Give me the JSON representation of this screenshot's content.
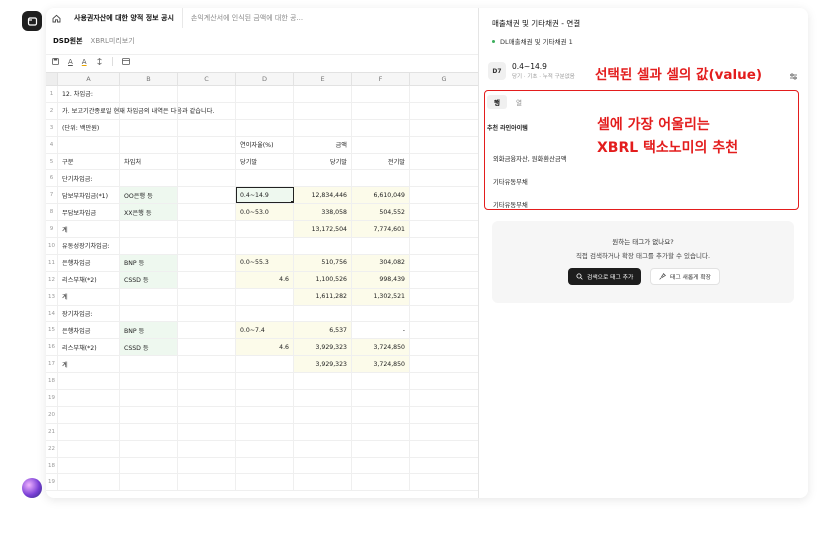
{
  "tabs": {
    "active": "사용권자산에 대한 양적 정보 공시",
    "inactive": "손익계산서에 인식된 금액에 대한 공..."
  },
  "subtabs": [
    "DSD원본",
    "XBRL미리보기"
  ],
  "toolbar": {
    "text_a": "A",
    "fill_a": "A"
  },
  "grid": {
    "columns": [
      "A",
      "B",
      "C",
      "D",
      "E",
      "F",
      "G"
    ],
    "rows": [
      {
        "n": "1",
        "a": "12. 차입금:",
        "b": "",
        "d": "",
        "e": "",
        "f": ""
      },
      {
        "n": "2",
        "a": "가. 보고기간종료일 현재 차입금의 내역은 다음과 같습니다.",
        "b": "",
        "d": "",
        "e": "",
        "f": ""
      },
      {
        "n": "3",
        "a": "(단위: 백만원)",
        "b": "",
        "d": "",
        "e": "",
        "f": ""
      },
      {
        "n": "4",
        "a": "",
        "b": "",
        "d": "연이자율(%)",
        "e": "금액",
        "f": ""
      },
      {
        "n": "5",
        "a": "구분",
        "b": "차입처",
        "d": "당기말",
        "e": "당기말",
        "f": "전기말"
      },
      {
        "n": "6",
        "a": "단기차입금:",
        "b": "",
        "d": "",
        "e": "",
        "f": ""
      },
      {
        "n": "7",
        "a": "담보부차입금(*1)",
        "b": "OO은행 등",
        "d": "0.4~14.9",
        "e": "12,834,446",
        "f": "6,610,049"
      },
      {
        "n": "8",
        "a": "무담보차입금",
        "b": "XX은행 등",
        "d": "0.0~53.0",
        "e": "338,058",
        "f": "504,552"
      },
      {
        "n": "9",
        "a": "계",
        "b": "",
        "d": "",
        "e": "13,172,504",
        "f": "7,774,601"
      },
      {
        "n": "10",
        "a": "유동성장기차입금:",
        "b": "",
        "d": "",
        "e": "",
        "f": ""
      },
      {
        "n": "11",
        "a": "은행차입금",
        "b": "BNP 등",
        "d": "0.0~55.3",
        "e": "510,756",
        "f": "304,082"
      },
      {
        "n": "12",
        "a": "리스부채(*2)",
        "b": "CSSD 등",
        "d": "4.6",
        "e": "1,100,526",
        "f": "998,439"
      },
      {
        "n": "13",
        "a": "계",
        "b": "",
        "d": "",
        "e": "1,611,282",
        "f": "1,302,521"
      },
      {
        "n": "14",
        "a": "장기차입금:",
        "b": "",
        "d": "",
        "e": "",
        "f": ""
      },
      {
        "n": "15",
        "a": "은행차입금",
        "b": "BNP 등",
        "d": "0.0~7.4",
        "e": "6,537",
        "f": "-"
      },
      {
        "n": "16",
        "a": "리스부채(*2)",
        "b": "CSSD 등",
        "d": "4.6",
        "e": "3,929,323",
        "f": "3,724,850"
      },
      {
        "n": "17",
        "a": "계",
        "b": "",
        "d": "",
        "e": "3,929,323",
        "f": "3,724,850"
      },
      {
        "n": "18",
        "a": "",
        "b": "",
        "d": "",
        "e": "",
        "f": ""
      },
      {
        "n": "19",
        "a": "",
        "b": "",
        "d": "",
        "e": "",
        "f": ""
      },
      {
        "n": "20",
        "a": "",
        "b": "",
        "d": "",
        "e": "",
        "f": ""
      },
      {
        "n": "21",
        "a": "",
        "b": "",
        "d": "",
        "e": "",
        "f": ""
      },
      {
        "n": "22",
        "a": "",
        "b": "",
        "d": "",
        "e": "",
        "f": ""
      },
      {
        "n": "18",
        "a": "",
        "b": "",
        "d": "",
        "e": "",
        "f": ""
      },
      {
        "n": "19",
        "a": "",
        "b": "",
        "d": "",
        "e": "",
        "f": ""
      }
    ]
  },
  "panel": {
    "title": "매출채권 및 기타채권 - 연결",
    "subtitle": "DL매출채권 및 기타채권 1",
    "cell_ref": "D7",
    "cell_value": "0.4~14.9",
    "cell_meta": "당기 · 기초 · 누적 구분없음",
    "tab_row": "행",
    "tab_col": "열",
    "rec_header": "추천 라인아이템",
    "rec_items": [
      "외화금융자산, 원화환산금액",
      "기타유동부채",
      "기타유동부채"
    ],
    "help_question": "원하는 태그가 없나요?",
    "help_desc": "직접 검색하거나 확장 태그를 추가할 수 있습니다.",
    "btn_search": "검색으로 태그 추가",
    "btn_new": "태그 새롭게 확장"
  },
  "annotations": {
    "a1": "선택된 셀과 셀의 값(value)",
    "a2": "셀에 가장 어울리는",
    "a3": "XBRL 택소노미의 추천"
  },
  "colors": {
    "annotation": "#e31d1d",
    "green_cell": "#eef8ef",
    "yellow_cell": "#fcfbea",
    "dot": "#3cae5c"
  }
}
